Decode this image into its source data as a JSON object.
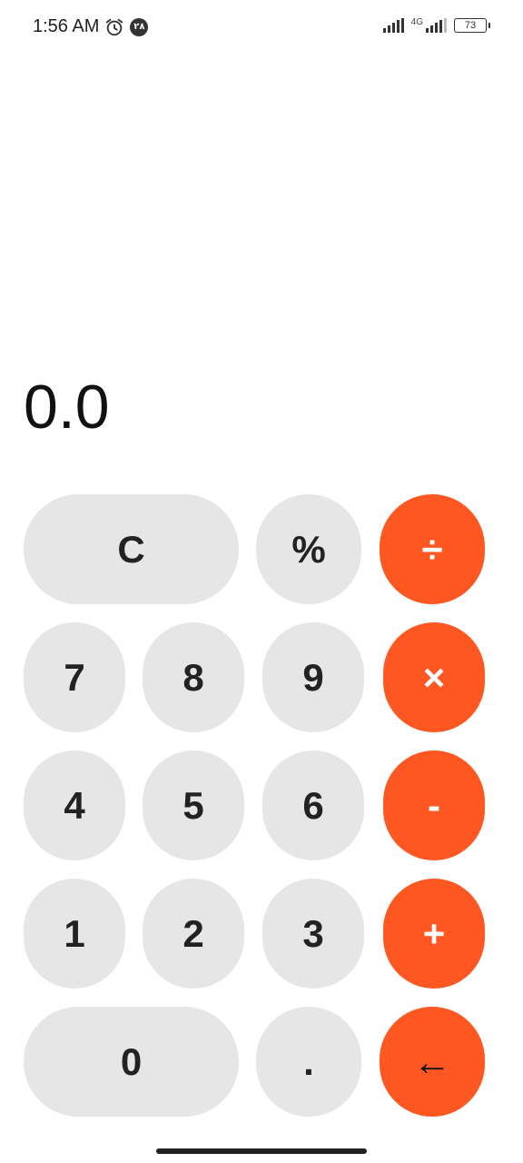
{
  "status_bar": {
    "time": "1:56 AM",
    "notification_badge": "۲۸",
    "network_type": "4G",
    "battery_level": "73"
  },
  "display": {
    "value": "0.0"
  },
  "keypad": {
    "clear": "C",
    "percent": "%",
    "divide": "÷",
    "seven": "7",
    "eight": "8",
    "nine": "9",
    "multiply": "×",
    "four": "4",
    "five": "5",
    "six": "6",
    "minus": "-",
    "one": "1",
    "two": "2",
    "three": "3",
    "plus": "+",
    "zero": "0",
    "decimal": ".",
    "backspace": "←"
  },
  "colors": {
    "operator": "#ff5722",
    "key_background": "#e6e6e6",
    "background": "#ffffff"
  }
}
